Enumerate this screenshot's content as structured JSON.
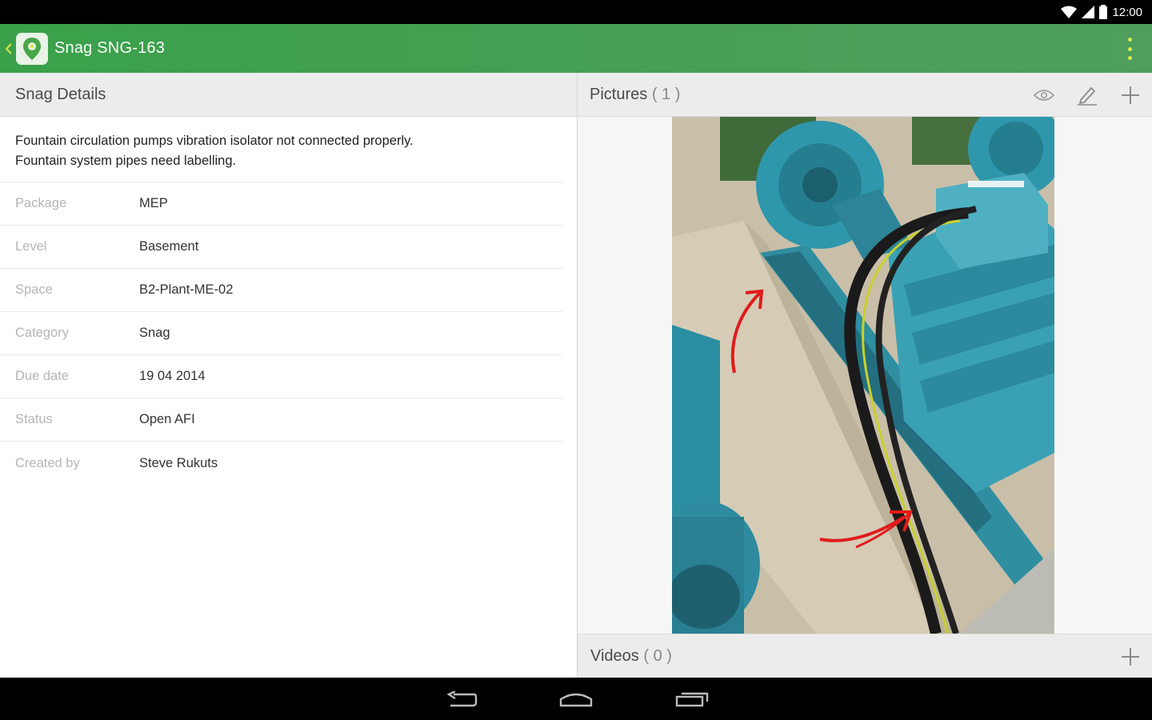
{
  "status_bar": {
    "time": "12:00"
  },
  "app_bar": {
    "title": "Snag SNG-163"
  },
  "details": {
    "header": "Snag Details",
    "description_line1": "Fountain circulation pumps vibration isolator not connected properly.",
    "description_line2": "Fountain system pipes need labelling.",
    "rows": [
      {
        "label": "Package",
        "value": "MEP"
      },
      {
        "label": "Level",
        "value": "Basement"
      },
      {
        "label": "Space",
        "value": "B2-Plant-ME-02"
      },
      {
        "label": "Category",
        "value": "Snag"
      },
      {
        "label": "Due date",
        "value": "19 04 2014"
      },
      {
        "label": "Status",
        "value": "Open AFI"
      },
      {
        "label": "Created by",
        "value": "Steve Rukuts"
      }
    ]
  },
  "pictures": {
    "title": "Pictures",
    "count": "( 1 )"
  },
  "videos": {
    "title": "Videos",
    "count": "( 0 )"
  },
  "colors": {
    "app_bar": "#3aa14a",
    "accent": "#d9e64a",
    "annotation": "#e01b1b"
  },
  "icons": [
    "back-icon",
    "app-logo-icon",
    "overflow-menu-icon",
    "eye-icon",
    "pencil-icon",
    "add-icon",
    "nav-back-icon",
    "nav-home-icon",
    "nav-recents-icon",
    "wifi-icon",
    "signal-icon",
    "battery-icon"
  ]
}
